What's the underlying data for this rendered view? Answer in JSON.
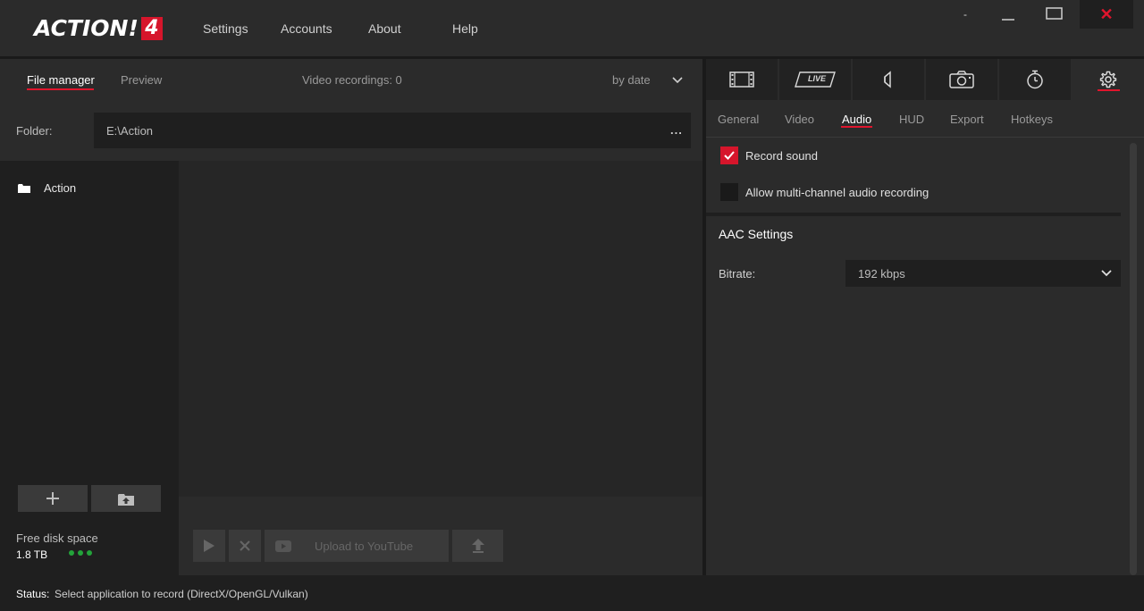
{
  "app": {
    "logo_text": "ACTION!",
    "logo_version": "4"
  },
  "menu": {
    "settings": "Settings",
    "accounts": "Accounts",
    "about": "About",
    "help": "Help"
  },
  "window_controls": {
    "minimize": "-",
    "close": "✕"
  },
  "left_tabs": {
    "file_manager": "File manager",
    "preview": "Preview"
  },
  "recordings_count_label": "Video recordings: 0",
  "sort": {
    "selected": "by date"
  },
  "folder": {
    "label": "Folder:",
    "path": "E:\\Action",
    "more": "..."
  },
  "tree": {
    "items": [
      {
        "label": "Action",
        "icon": "folder-icon"
      }
    ]
  },
  "disk": {
    "label": "Free disk space",
    "value": "1.8 TB",
    "status_color": "#23a33a"
  },
  "player_controls": {
    "upload_label": "Upload to YouTube"
  },
  "icon_tabs": [
    {
      "name": "video-recording",
      "icon": "film-icon"
    },
    {
      "name": "live-streaming",
      "icon": "live-icon",
      "text": "LIVE"
    },
    {
      "name": "audio",
      "icon": "speaker-icon"
    },
    {
      "name": "screenshot",
      "icon": "camera-icon"
    },
    {
      "name": "timer",
      "icon": "stopwatch-icon"
    },
    {
      "name": "settings",
      "icon": "gear-icon",
      "active": true
    }
  ],
  "settings_tabs": {
    "general": "General",
    "video": "Video",
    "audio": "Audio",
    "hud": "HUD",
    "export": "Export",
    "hotkeys": "Hotkeys",
    "active": "Audio"
  },
  "audio_settings": {
    "record_sound": {
      "label": "Record sound",
      "checked": true
    },
    "multichannel": {
      "label": "Allow multi-channel audio recording",
      "checked": false
    },
    "aac_title": "AAC Settings",
    "bitrate_label": "Bitrate:",
    "bitrate_value": "192 kbps"
  },
  "status": {
    "label": "Status:",
    "text": "Select application to record  (DirectX/OpenGL/Vulkan)"
  },
  "colors": {
    "accent": "#d6152b",
    "background": "#2b2b2b",
    "panel_dark": "#1f1f1f"
  }
}
